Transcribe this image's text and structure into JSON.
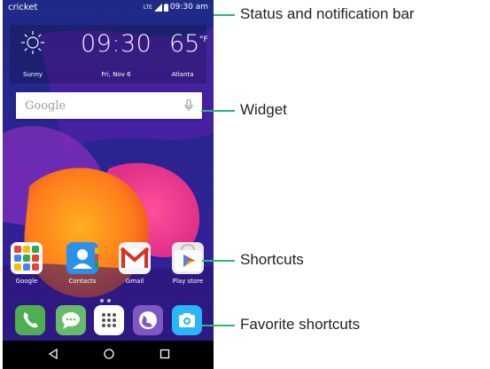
{
  "status_bar": {
    "carrier": "cricket",
    "network": "LTE",
    "time": "09:30 am"
  },
  "weather_widget": {
    "time": "09:30",
    "temperature": "65",
    "unit": "°F",
    "condition": "Sunny",
    "date": "Fri, Nov 6",
    "city": "Atlanta",
    "icon": "sun-icon"
  },
  "search_widget": {
    "placeholder": "Google",
    "icon": "mic-icon"
  },
  "shortcuts": [
    {
      "label": "Google",
      "icon": "google-folder-icon"
    },
    {
      "label": "Contacts",
      "icon": "contacts-icon"
    },
    {
      "label": "Gmail",
      "icon": "gmail-icon"
    },
    {
      "label": "Play store",
      "icon": "play-store-icon"
    }
  ],
  "favorites": [
    {
      "icon": "phone-icon",
      "color": "#4caf50"
    },
    {
      "icon": "messaging-icon",
      "color": "#66bb6a"
    },
    {
      "icon": "app-drawer-icon",
      "color": "#ffffff"
    },
    {
      "icon": "browser-icon",
      "color": "#7e57c2"
    },
    {
      "icon": "camera-icon",
      "color": "#29b6f6"
    }
  ],
  "navigation": [
    "back-icon",
    "home-icon",
    "recents-icon"
  ],
  "callouts": {
    "status": "Status and notification bar",
    "widget": "Widget",
    "shortcuts": "Shortcuts",
    "favorites": "Favorite shortcuts"
  },
  "colors": {
    "callout_line": "#2bb673",
    "wallpaper_base": "#2a1f8e"
  }
}
